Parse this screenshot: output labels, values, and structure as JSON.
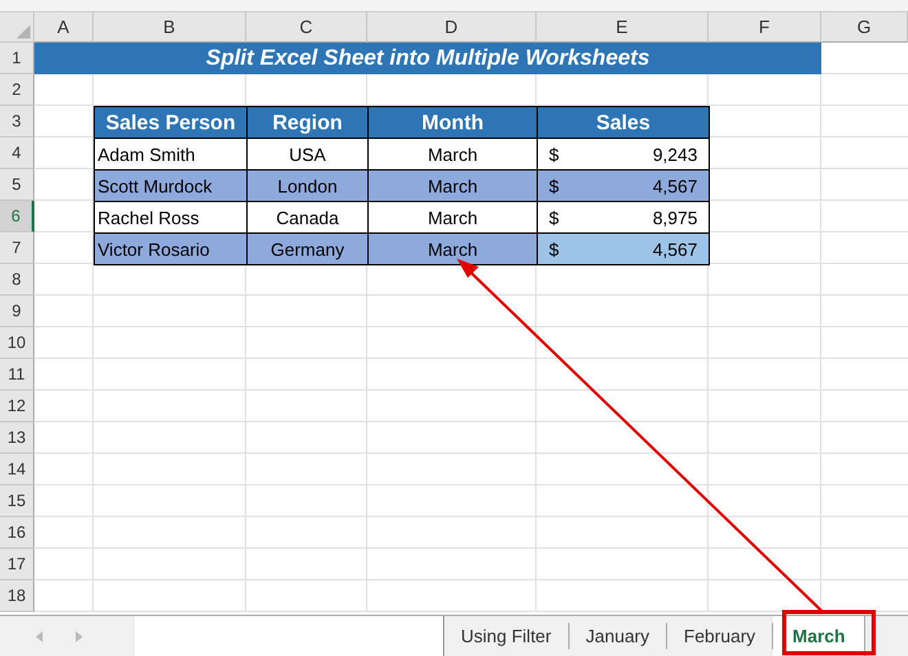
{
  "columns": [
    {
      "label": "A"
    },
    {
      "label": "B"
    },
    {
      "label": "C"
    },
    {
      "label": "D"
    },
    {
      "label": "E"
    },
    {
      "label": "F"
    },
    {
      "label": "G"
    }
  ],
  "row_headers": [
    {
      "label": "1",
      "selected": false
    },
    {
      "label": "2",
      "selected": false
    },
    {
      "label": "3",
      "selected": false
    },
    {
      "label": "4",
      "selected": false
    },
    {
      "label": "5",
      "selected": false
    },
    {
      "label": "6",
      "selected": true
    },
    {
      "label": "7",
      "selected": false
    },
    {
      "label": "8",
      "selected": false
    },
    {
      "label": "9",
      "selected": false
    },
    {
      "label": "10",
      "selected": false
    },
    {
      "label": "11",
      "selected": false
    },
    {
      "label": "12",
      "selected": false
    },
    {
      "label": "13",
      "selected": false
    },
    {
      "label": "14",
      "selected": false
    },
    {
      "label": "15",
      "selected": false
    },
    {
      "label": "16",
      "selected": false
    },
    {
      "label": "17",
      "selected": false
    },
    {
      "label": "18",
      "selected": false
    }
  ],
  "title": "Split Excel Sheet into Multiple Worksheets",
  "table": {
    "headers": [
      "Sales Person",
      "Region",
      "Month",
      "Sales"
    ],
    "rows": [
      {
        "person": "Adam Smith",
        "region": "USA",
        "month": "March",
        "currency": "$",
        "amount": "9,243",
        "shaded": false,
        "selected": false
      },
      {
        "person": "Scott Murdock",
        "region": "London",
        "month": "March",
        "currency": "$",
        "amount": "4,567",
        "shaded": true,
        "selected": false
      },
      {
        "person": "Rachel Ross",
        "region": "Canada",
        "month": "March",
        "currency": "$",
        "amount": "8,975",
        "shaded": false,
        "selected": false
      },
      {
        "person": "Victor Rosario",
        "region": "Germany",
        "month": "March",
        "currency": "$",
        "amount": "4,567",
        "shaded": true,
        "selected": true
      }
    ]
  },
  "sheet_tabs": [
    {
      "label": "Using Filter",
      "selected": false
    },
    {
      "label": "January",
      "selected": false
    },
    {
      "label": "February",
      "selected": false
    },
    {
      "label": "March",
      "selected": true
    }
  ]
}
